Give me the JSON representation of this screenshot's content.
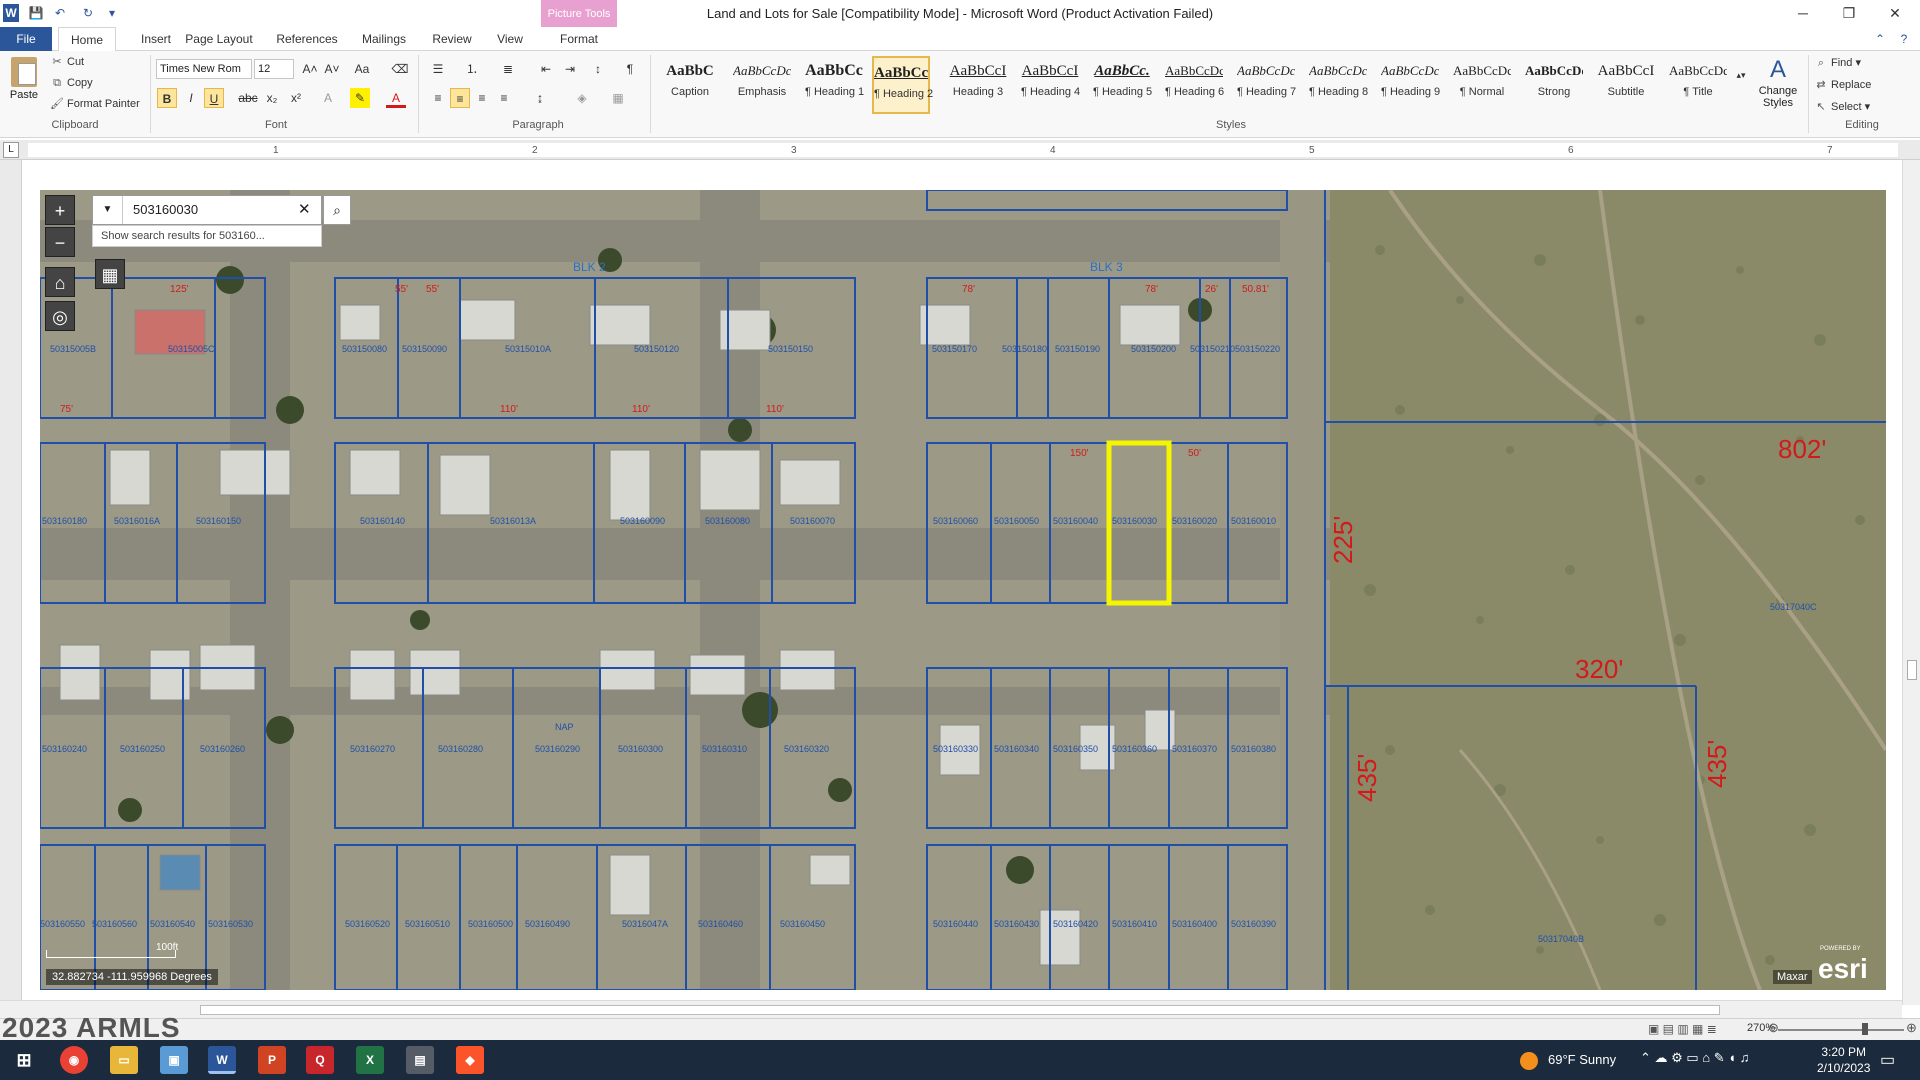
{
  "window": {
    "title": "Land and Lots for Sale [Compatibility Mode]  -  Microsoft Word (Product Activation Failed)",
    "picture_tools": "Picture Tools"
  },
  "tabs": [
    "File",
    "Home",
    "Insert",
    "Page Layout",
    "References",
    "Mailings",
    "Review",
    "View",
    "Format"
  ],
  "clipboard": {
    "paste": "Paste",
    "cut": "Cut",
    "copy": "Copy",
    "format_painter": "Format Painter",
    "label": "Clipboard"
  },
  "font": {
    "name": "Times New Rom",
    "size": "12",
    "label": "Font"
  },
  "paragraph": {
    "label": "Paragraph"
  },
  "styles": {
    "label": "Styles",
    "items": [
      {
        "preview": "AaBbC",
        "name": "Caption"
      },
      {
        "preview": "AaBbCcDc",
        "name": "Emphasis"
      },
      {
        "preview": "AaBbCc",
        "name": "¶ Heading 1"
      },
      {
        "preview": "AaBbCcI",
        "name": "¶ Heading 2"
      },
      {
        "preview": "AaBbCcI",
        "name": "Heading 3"
      },
      {
        "preview": "AaBbCcI",
        "name": "¶ Heading 4"
      },
      {
        "preview": "AaBbCc.",
        "name": "¶ Heading 5"
      },
      {
        "preview": "AaBbCcDc",
        "name": "¶ Heading 6"
      },
      {
        "preview": "AaBbCcDc",
        "name": "¶ Heading 7"
      },
      {
        "preview": "AaBbCcDc",
        "name": "¶ Heading 8"
      },
      {
        "preview": "AaBbCcDc",
        "name": "¶ Heading 9"
      },
      {
        "preview": "AaBbCcDc",
        "name": "¶ Normal"
      },
      {
        "preview": "AaBbCcDd",
        "name": "Strong"
      },
      {
        "preview": "AaBbCcI",
        "name": "Subtitle"
      },
      {
        "preview": "AaBbCcDdI",
        "name": "¶ Title"
      }
    ],
    "change_styles": "Change Styles"
  },
  "editing": {
    "find": "Find",
    "replace": "Replace",
    "select": "Select",
    "label": "Editing"
  },
  "ruler": {
    "numbers": [
      "1",
      "2",
      "3",
      "4",
      "5",
      "6",
      "7"
    ]
  },
  "map": {
    "search_value": "503160030",
    "suggestion": "Show search results for 503160...",
    "block_labels": [
      "BLK 2",
      "BLK 3"
    ],
    "big_dims": [
      "802'",
      "225'",
      "320'",
      "435'",
      "435'"
    ],
    "scale": "100ft",
    "coords": "32.882734 -111.959968 Degrees",
    "maxar": "Maxar",
    "esri": "esri",
    "powered": "POWERED BY",
    "parcels_row1": [
      "50315005B",
      "50315005C",
      "503150080",
      "503150090",
      "50315010A",
      "503150120",
      "503150150",
      "503150170",
      "503150180",
      "503150190",
      "503150200",
      "503150210",
      "503150220"
    ],
    "parcels_row2": [
      "503160180",
      "50316016A",
      "503160150",
      "503160140",
      "50316013A",
      "503160090",
      "503160080",
      "503160070",
      "503160060",
      "503160050",
      "503160040",
      "503160030",
      "503160020",
      "503160010"
    ],
    "parcels_row3": [
      "503160240",
      "503160250",
      "503160260",
      "503160270",
      "503160280",
      "503160290",
      "503160300",
      "503160310",
      "503160320",
      "503160330",
      "503160340",
      "503160350",
      "503160360",
      "503160370",
      "503160380"
    ],
    "parcels_row4": [
      "503160550",
      "503160560",
      "503160540",
      "503160530",
      "503160520",
      "503160510",
      "503160500",
      "503160490",
      "50316047A",
      "503160460",
      "503160450",
      "503160440",
      "503160430",
      "503160420",
      "503160410",
      "503160400",
      "503160390"
    ],
    "parcel_big": [
      "50317040C",
      "50317040B"
    ],
    "row1_dims": [
      "125'",
      "55'",
      "55'",
      "110'",
      "110'",
      "110'",
      "78'",
      "78'",
      "26'",
      "50.81'"
    ],
    "row2_dims": [
      "75'",
      "150'",
      "50'"
    ],
    "nap": "NAP"
  },
  "status": {
    "watermark": "2023 ARMLS",
    "zoom": "270%"
  },
  "taskbar": {
    "weather": "69°F  Sunny",
    "time": "3:20 PM",
    "date": "2/10/2023"
  },
  "colors": {
    "word_blue": "#2b579a",
    "parcel_line": "#1f4fa8",
    "highlight": "#f5f500",
    "dim_red": "#d21a1a"
  }
}
